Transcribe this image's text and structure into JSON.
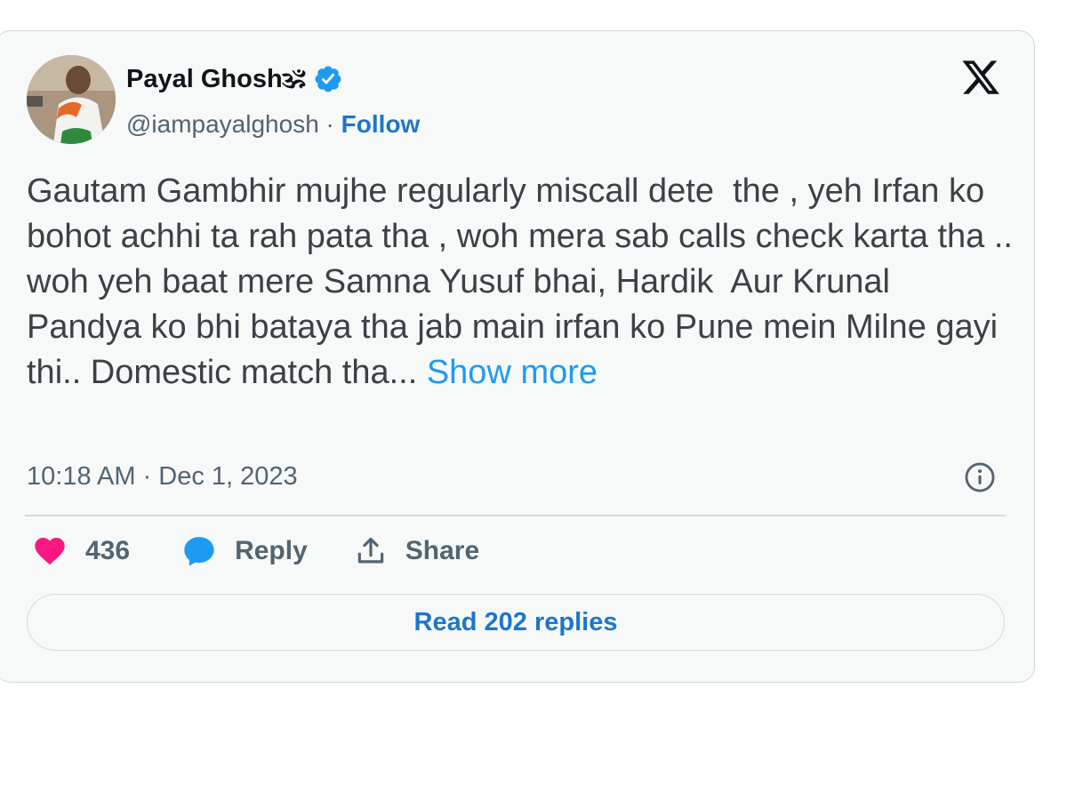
{
  "author": {
    "name": "Payal Ghosh🕉",
    "handle": "@iampayalghosh",
    "separator": " · ",
    "follow_label": "Follow",
    "verified_color": "#1d9bf0"
  },
  "tweet": {
    "text": "Gautam Gambhir mujhe regularly miscall dete  the , yeh Irfan ko bohot achhi ta rah pata tha , woh mera sab calls check karta tha .. woh yeh baat mere Samna Yusuf bhai, Hardik  Aur Krunal Pandya ko bhi bataya tha jab main irfan ko Pune mein Milne gayi thi.. Domestic match tha... ",
    "show_more_label": "Show more",
    "timestamp": "10:18 AM · Dec 1, 2023"
  },
  "actions": {
    "like_count": "436",
    "reply_label": "Reply",
    "share_label": "Share"
  },
  "read_replies_label": "Read 202 replies",
  "icons": {
    "logo": "x-logo-icon",
    "info": "info-icon",
    "like": "heart-icon",
    "reply": "speech-bubble-icon",
    "share": "share-icon",
    "verified": "verified-badge-icon"
  },
  "colors": {
    "like": "#f91880",
    "reply": "#1d9bf0",
    "link": "#1d76c9",
    "show_more": "#1d9bf0"
  }
}
